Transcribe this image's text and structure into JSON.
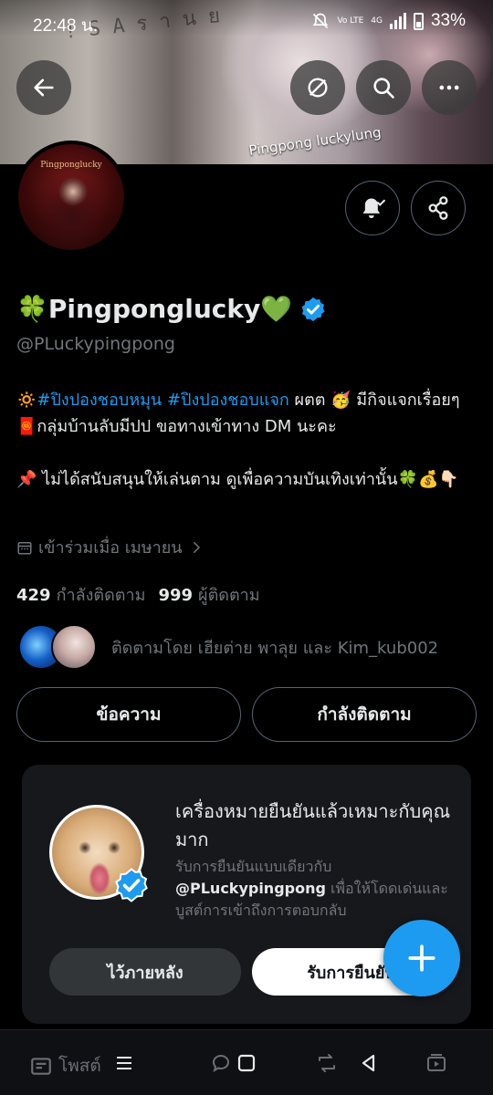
{
  "status": {
    "time": "22:48 น.",
    "network": "Vo LTE",
    "network_type": "4G",
    "battery": "33%"
  },
  "banner": {
    "watermark": "Pingpong luckylung",
    "doodle_text": "! S A  ร  า  น  ย"
  },
  "profile": {
    "display_name": "🍀Pingponglucky💚",
    "handle": "@PLuckypingpong",
    "avatar_caption": "Pingponglucky",
    "bio_line1_prefix": "🔅",
    "bio_tag1": "#ปิงปองชอบหมุน",
    "bio_tag2": "#ปิงปองชอบแจก",
    "bio_line1_rest": " ผตต 🥳 มีกิจแจกเรื่อยๆ🧧กลุ่มบ้านลับมีปป ขอทางเข้าทาง DM นะคะ",
    "bio_line2": "📌 ไม่ได้สนับสนุนให้เล่นตาม ดูเพื่อความบันเทิงเท่านั้น🍀💰👇🏻",
    "joined": "เข้าร่วมเมื่อ เมษายน",
    "following_count": "429",
    "following_label": "กำลังติดตาม",
    "followers_count": "999",
    "followers_label": "ผู้ติดตาม",
    "followed_by": "ติดตามโดย เฮียต่าย พาลุย และ Kim_kub002"
  },
  "actions": {
    "message": "ข้อความ",
    "following": "กำลังติดตาม"
  },
  "card": {
    "title": "เครื่องหมายยืนยันแล้วเหมาะกับคุณมาก",
    "desc_prefix": "รับการยืนยันแบบเดียวกับ ",
    "desc_handle": "@PLuckypingpong",
    "desc_suffix": " เพื่อให้โดดเด่นและบูสต์การเข้าถึงการตอบกลับ",
    "later": "ไว้ภายหลัง",
    "get": "รับการยืนยัน"
  },
  "tabs": {
    "posts": "โพสต์"
  },
  "colors": {
    "accent": "#1d9bf0",
    "background": "#000000",
    "muted": "#71767b"
  },
  "icons": [
    "back-arrow-icon",
    "hide-icon",
    "search-icon",
    "more-icon",
    "bell-check-icon",
    "share-icon",
    "verified-icon",
    "calendar-icon",
    "chevron-right-icon",
    "plus-icon",
    "posts-icon",
    "reply-icon",
    "repost-icon",
    "media-icon",
    "recents-icon",
    "home-icon",
    "back-icon"
  ]
}
